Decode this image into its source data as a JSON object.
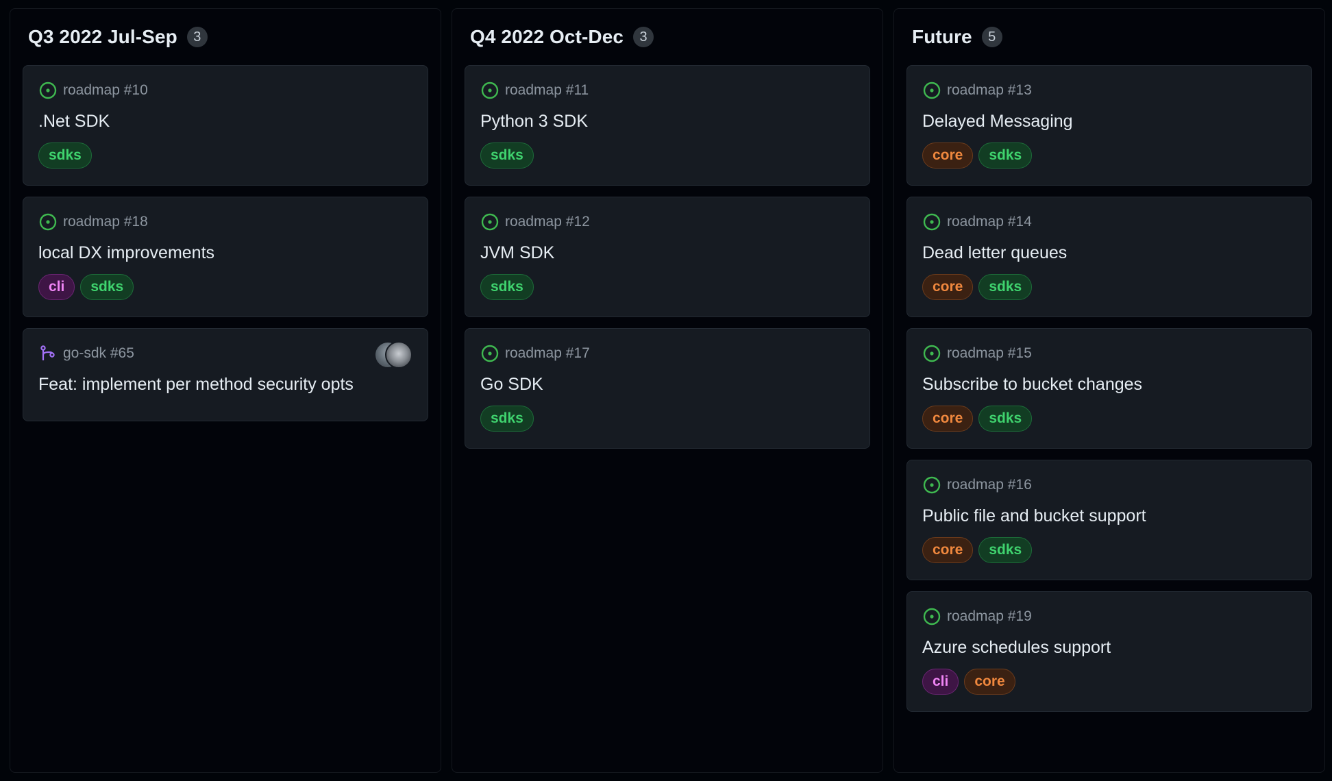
{
  "columns": [
    {
      "title": "Q3 2022 Jul-Sep",
      "count": "3",
      "cards": [
        {
          "type": "issue",
          "ref": "roadmap #10",
          "title": ".Net SDK",
          "labels": [
            "sdks"
          ]
        },
        {
          "type": "issue",
          "ref": "roadmap #18",
          "title": "local DX improvements",
          "labels": [
            "cli",
            "sdks"
          ]
        },
        {
          "type": "pull-request",
          "ref": "go-sdk #65",
          "title": "Feat: implement per method security opts",
          "labels": []
        }
      ]
    },
    {
      "title": "Q4 2022 Oct-Dec",
      "count": "3",
      "cards": [
        {
          "type": "issue",
          "ref": "roadmap #11",
          "title": "Python 3 SDK",
          "labels": [
            "sdks"
          ]
        },
        {
          "type": "issue",
          "ref": "roadmap #12",
          "title": "JVM SDK",
          "labels": [
            "sdks"
          ]
        },
        {
          "type": "issue",
          "ref": "roadmap #17",
          "title": "Go SDK",
          "labels": [
            "sdks"
          ]
        }
      ]
    },
    {
      "title": "Future",
      "count": "5",
      "cards": [
        {
          "type": "issue",
          "ref": "roadmap #13",
          "title": "Delayed Messaging",
          "labels": [
            "core",
            "sdks"
          ]
        },
        {
          "type": "issue",
          "ref": "roadmap #14",
          "title": "Dead letter queues",
          "labels": [
            "core",
            "sdks"
          ]
        },
        {
          "type": "issue",
          "ref": "roadmap #15",
          "title": "Subscribe to bucket changes",
          "labels": [
            "core",
            "sdks"
          ]
        },
        {
          "type": "issue",
          "ref": "roadmap #16",
          "title": "Public file and bucket support",
          "labels": [
            "core",
            "sdks"
          ]
        },
        {
          "type": "issue",
          "ref": "roadmap #19",
          "title": "Azure schedules support",
          "labels": [
            "cli",
            "core"
          ]
        }
      ]
    }
  ],
  "icons": {
    "issue": "issue-opened-icon",
    "pull-request": "git-pull-request-icon"
  },
  "colors": {
    "issue_open": "#3fb950",
    "pull_request": "#a371f7",
    "label_sdks": "#3fd36e",
    "label_core": "#f0883e",
    "label_cli": "#f085f5"
  }
}
